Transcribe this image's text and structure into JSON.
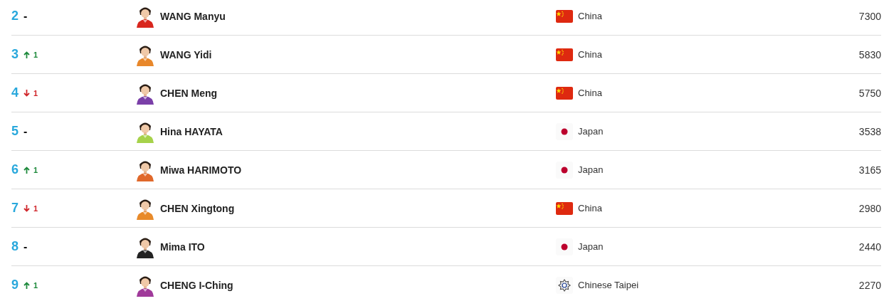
{
  "rankings": [
    {
      "rank": "2",
      "change": {
        "kind": "none",
        "text": "-"
      },
      "name": "WANG Manyu",
      "flag": {
        "kind": "china"
      },
      "country": "China",
      "points": "7300"
    },
    {
      "rank": "3",
      "change": {
        "kind": "up",
        "text": "1"
      },
      "name": "WANG Yidi",
      "flag": {
        "kind": "china"
      },
      "country": "China",
      "points": "5830"
    },
    {
      "rank": "4",
      "change": {
        "kind": "down",
        "text": "1"
      },
      "name": "CHEN Meng",
      "flag": {
        "kind": "china"
      },
      "country": "China",
      "points": "5750"
    },
    {
      "rank": "5",
      "change": {
        "kind": "none",
        "text": "-"
      },
      "name": "Hina HAYATA",
      "flag": {
        "kind": "japan"
      },
      "country": "Japan",
      "points": "3538"
    },
    {
      "rank": "6",
      "change": {
        "kind": "up",
        "text": "1"
      },
      "name": "Miwa HARIMOTO",
      "flag": {
        "kind": "japan"
      },
      "country": "Japan",
      "points": "3165"
    },
    {
      "rank": "7",
      "change": {
        "kind": "down",
        "text": "1"
      },
      "name": "CHEN Xingtong",
      "flag": {
        "kind": "china"
      },
      "country": "China",
      "points": "2980"
    },
    {
      "rank": "8",
      "change": {
        "kind": "none",
        "text": "-"
      },
      "name": "Mima ITO",
      "flag": {
        "kind": "japan"
      },
      "country": "Japan",
      "points": "2440"
    },
    {
      "rank": "9",
      "change": {
        "kind": "up",
        "text": "1"
      },
      "name": "CHENG I-Ching",
      "flag": {
        "kind": "chinese-taipei"
      },
      "country": "Chinese Taipei",
      "points": "2270"
    }
  ]
}
